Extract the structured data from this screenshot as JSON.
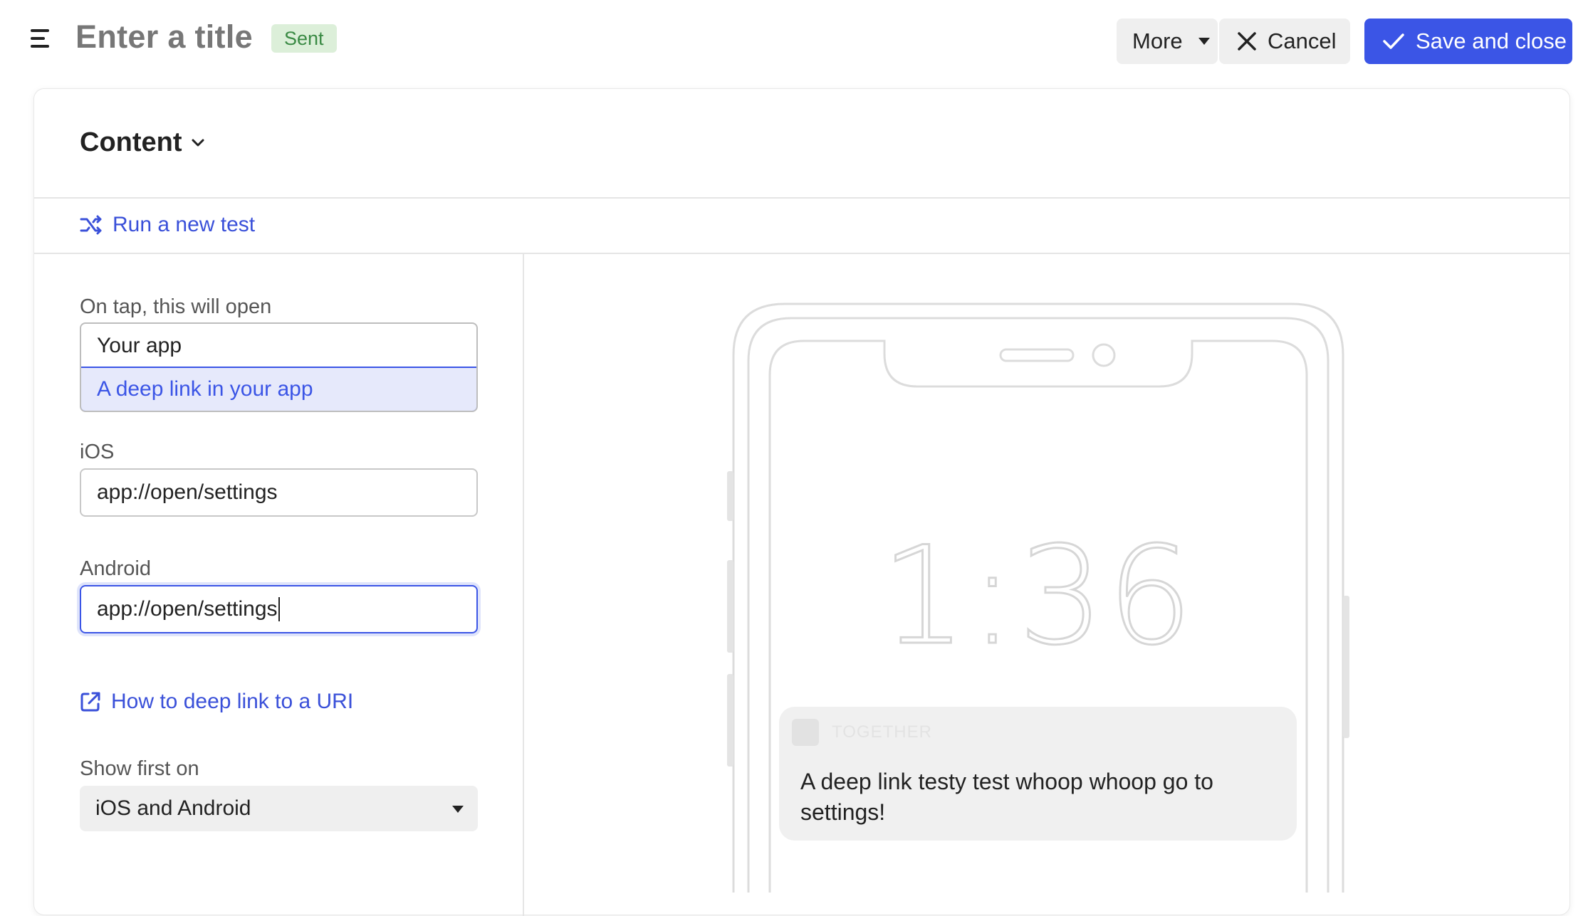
{
  "header": {
    "title_placeholder": "Enter a title",
    "status_badge": "Sent",
    "more_label": "More",
    "cancel_label": "Cancel",
    "save_label": "Save and close"
  },
  "content": {
    "section_title": "Content",
    "run_test_label": "Run a new test"
  },
  "form": {
    "on_tap_label": "On tap, this will open",
    "on_tap_options": [
      "Your app",
      "A deep link in your app"
    ],
    "on_tap_selected": "A deep link in your app",
    "ios_label": "iOS",
    "ios_value": "app://open/settings",
    "android_label": "Android",
    "android_value": "app://open/settings",
    "help_link": "How to deep link to a URI",
    "show_first_label": "Show first on",
    "show_first_value": "iOS and Android"
  },
  "preview": {
    "time": "1:36",
    "app_name": "TOGETHER",
    "notification_text": "A deep link testy test whoop whoop go to settings!"
  },
  "colors": {
    "accent": "#3b55e6",
    "link": "#3a50d9",
    "badge_bg": "#dcefd9",
    "badge_text": "#3a8a44"
  }
}
